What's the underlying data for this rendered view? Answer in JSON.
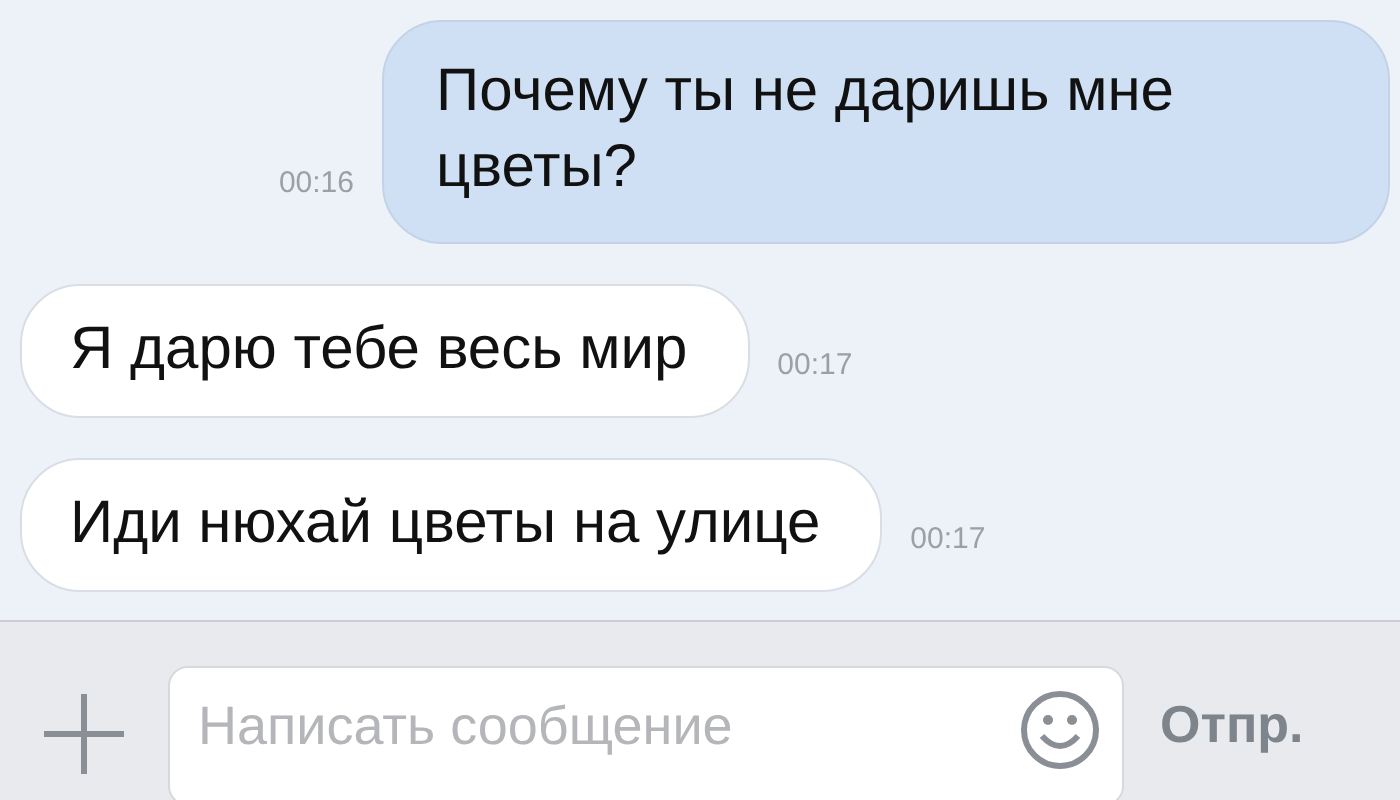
{
  "messages": [
    {
      "kind": "outgoing",
      "text": "Почему ты не даришь мне цветы?",
      "time": "00:16"
    },
    {
      "kind": "incoming",
      "text": "Я дарю тебе весь мир",
      "time": "00:17"
    },
    {
      "kind": "incoming",
      "text": "Иди нюхай цветы на улице",
      "time": "00:17"
    }
  ],
  "composer": {
    "placeholder": "Написать сообщение",
    "send": "Отпр."
  }
}
